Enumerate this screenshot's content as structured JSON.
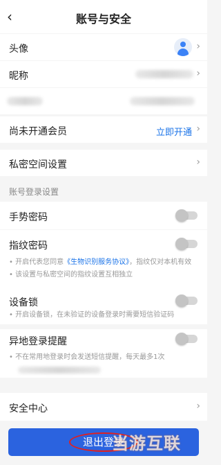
{
  "header": {
    "title": "账号与安全",
    "back_icon": "back-icon"
  },
  "profile": {
    "avatar_label": "头像",
    "nickname_label": "昵称",
    "vip_label": "尚未开通会员",
    "vip_action": "立即开通",
    "private_space_label": "私密空间设置"
  },
  "login_settings": {
    "section_title": "账号登录设置",
    "gesture_label": "手势密码",
    "fingerprint_label": "指纹密码",
    "fingerprint_note_prefix": "• 开启代表您同意",
    "fingerprint_note_link": "《生物识别服务协议》",
    "fingerprint_note_suffix": "，指纹仅对本机有效",
    "fingerprint_note_2": "• 该设置与私密空间的指纹设置互相独立",
    "device_lock_label": "设备锁",
    "device_lock_note": "• 开启设备锁，在未验证的设备登录时需要短信验证码",
    "remote_login_label": "异地登录提醒",
    "remote_login_note": "• 不在常用地登录时会发送短信提醒，每天最多1次",
    "toggles": {
      "gesture": false,
      "fingerprint": false,
      "device_lock": false,
      "remote_login": false
    }
  },
  "security_center_label": "安全中心",
  "logout_label": "退出登录",
  "watermark": "当游互联",
  "colors": {
    "accent": "#1a73e8",
    "button": "#2b63df",
    "highlight_ring": "#e02020"
  }
}
